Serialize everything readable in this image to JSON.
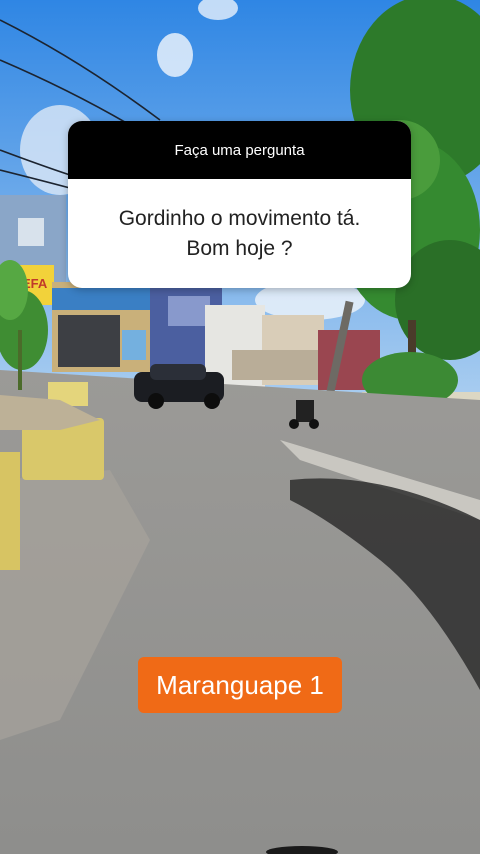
{
  "question_box": {
    "header": "Faça uma pergunta",
    "question_line1": "Gordinho o movimento tá.",
    "question_line2": "Bom hoje ?"
  },
  "caption": {
    "text": "Maranguape 1"
  },
  "shop_sign": {
    "text": "ZEFA"
  },
  "colors": {
    "caption_bg": "#f06a16",
    "header_bg": "#000000",
    "sky": "#3b8ee6"
  }
}
